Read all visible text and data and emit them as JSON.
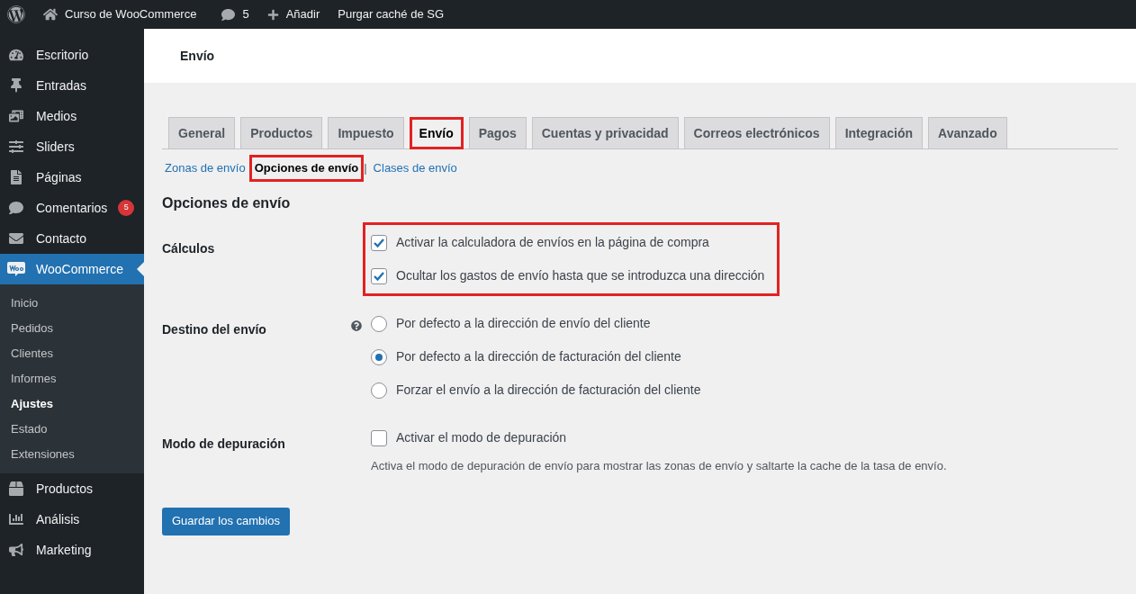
{
  "admin_bar": {
    "site_name": "Curso de WooCommerce",
    "comments_count": "5",
    "add_label": "Añadir",
    "purge_label": "Purgar caché de SG"
  },
  "sidebar": {
    "items": [
      {
        "label": "Escritorio",
        "selected": false
      },
      {
        "label": "Entradas",
        "selected": false
      },
      {
        "label": "Medios",
        "selected": false
      },
      {
        "label": "Sliders",
        "selected": false
      },
      {
        "label": "Páginas",
        "selected": false
      },
      {
        "label": "Comentarios",
        "badge": "5",
        "selected": false
      },
      {
        "label": "Contacto",
        "selected": false
      },
      {
        "label": "WooCommerce",
        "selected": true,
        "children": [
          {
            "label": "Inicio",
            "selected": false
          },
          {
            "label": "Pedidos",
            "selected": false
          },
          {
            "label": "Clientes",
            "selected": false
          },
          {
            "label": "Informes",
            "selected": false
          },
          {
            "label": "Ajustes",
            "selected": true
          },
          {
            "label": "Estado",
            "selected": false
          },
          {
            "label": "Extensiones",
            "selected": false
          }
        ]
      },
      {
        "label": "Productos",
        "selected": false
      },
      {
        "label": "Análisis",
        "selected": false
      },
      {
        "label": "Marketing",
        "selected": false
      }
    ]
  },
  "page_title": "Envío",
  "tabs": [
    {
      "label": "General",
      "selected": false,
      "highlighted": false
    },
    {
      "label": "Productos",
      "selected": false,
      "highlighted": false
    },
    {
      "label": "Impuesto",
      "selected": false,
      "highlighted": false
    },
    {
      "label": "Envío",
      "selected": true,
      "highlighted": true
    },
    {
      "label": "Pagos",
      "selected": false,
      "highlighted": false
    },
    {
      "label": "Cuentas y privacidad",
      "selected": false,
      "highlighted": false
    },
    {
      "label": "Correos electrónicos",
      "selected": false,
      "highlighted": false
    },
    {
      "label": "Integración",
      "selected": false,
      "highlighted": false
    },
    {
      "label": "Avanzado",
      "selected": false,
      "highlighted": false
    }
  ],
  "subnav": [
    {
      "label": "Zonas de envío",
      "selected": false,
      "highlighted": false
    },
    {
      "label": "Opciones de envío",
      "selected": true,
      "highlighted": true,
      "separator": "|"
    },
    {
      "label": "Clases de envío",
      "selected": false,
      "highlighted": false
    }
  ],
  "section_title": "Opciones de envío",
  "settings": [
    {
      "label": "Cálculos",
      "kind": "checkboxes",
      "help": false,
      "highlighted": true,
      "options": [
        {
          "label": "Activar la calculadora de envíos en la página de compra",
          "checked": true
        },
        {
          "label": "Ocultar los gastos de envío hasta que se introduzca una dirección",
          "checked": true
        }
      ]
    },
    {
      "label": "Destino del envío",
      "kind": "radios",
      "help": true,
      "highlighted": false,
      "options": [
        {
          "label": "Por defecto a la dirección de envío del cliente",
          "selected": false
        },
        {
          "label": "Por defecto a la dirección de facturación del cliente",
          "selected": true
        },
        {
          "label": "Forzar el envío a la dirección de facturación del cliente",
          "selected": false
        }
      ]
    },
    {
      "label": "Modo de depuración",
      "kind": "checkboxes",
      "help": false,
      "highlighted": false,
      "options": [
        {
          "label": "Activar el modo de depuración",
          "checked": false
        }
      ],
      "description": "Activa el modo de depuración de envío para mostrar las zonas de envío y saltarte la cache de la tasa de envío."
    }
  ],
  "save_button": "Guardar los cambios"
}
